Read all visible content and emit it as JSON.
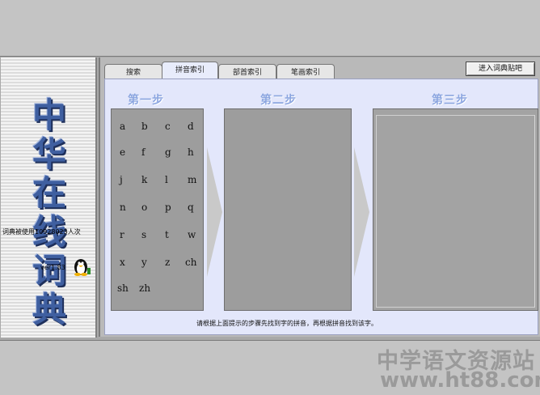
{
  "left": {
    "logo_chars": [
      "中",
      "华",
      "在",
      "线",
      "词",
      "典"
    ],
    "usage": "词典被使用10928023人次",
    "version": "ver1.83",
    "mascot_icon": "penguin-icon"
  },
  "tabs": [
    {
      "label": "搜索",
      "active": false
    },
    {
      "label": "拼音索引",
      "active": true
    },
    {
      "label": "部首索引",
      "active": false
    },
    {
      "label": "笔画索引",
      "active": false
    }
  ],
  "enter_button": "进入词典贴吧",
  "steps": [
    "第一步",
    "第二步",
    "第三步"
  ],
  "letters": [
    [
      "a",
      "b",
      "c",
      "d"
    ],
    [
      "e",
      "f",
      "g",
      "h"
    ],
    [
      "j",
      "k",
      "l",
      "m"
    ],
    [
      "n",
      "o",
      "p",
      "q"
    ],
    [
      "r",
      "s",
      "t",
      "w"
    ],
    [
      "x",
      "y",
      "z",
      "ch"
    ],
    [
      "sh",
      "zh"
    ]
  ],
  "hint": "请根据上面提示的步骤先找到字的拼音，再根据拼音找到该字。",
  "watermark": {
    "line1": "中学语文资源站",
    "line2": "www.ht88.com"
  }
}
